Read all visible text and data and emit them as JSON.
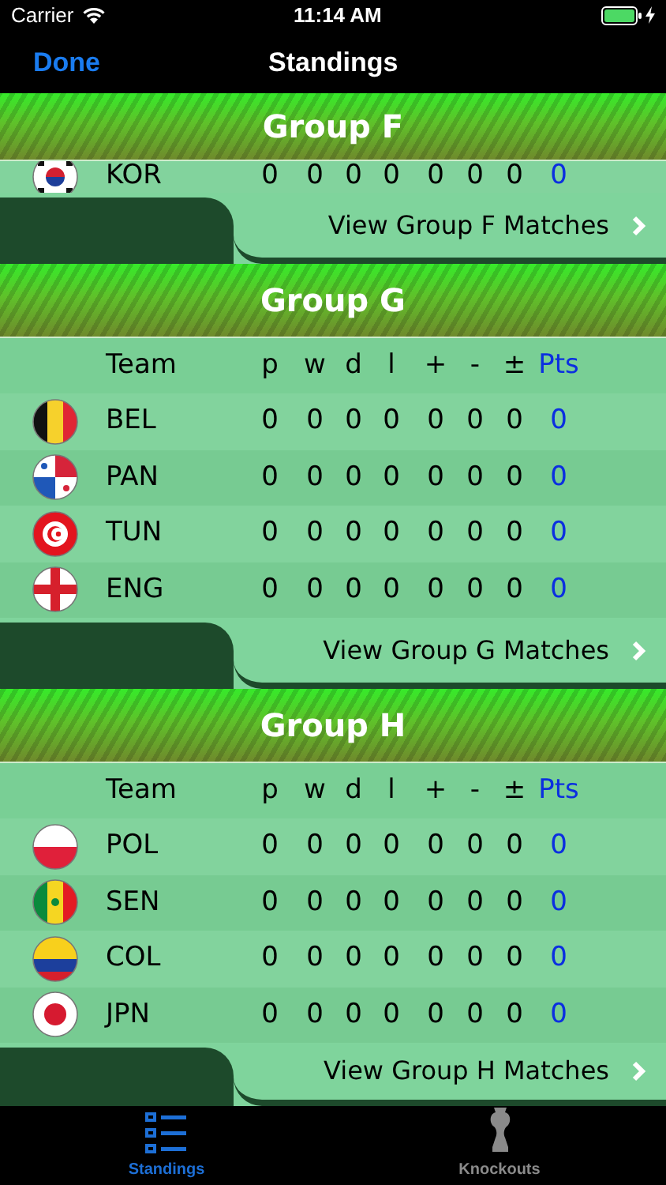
{
  "status_bar": {
    "carrier": "Carrier",
    "time": "11:14 AM"
  },
  "nav": {
    "back": "Done",
    "title": "Standings"
  },
  "groups": [
    {
      "title": "Group F",
      "partly_hidden": true,
      "teams": [
        {
          "kind": "kor",
          "code": "KOR",
          "stats": [
            "0",
            "0",
            "0",
            "0",
            "0",
            "0",
            "0"
          ],
          "pts": "0"
        }
      ],
      "footer": "View Group F Matches"
    },
    {
      "title": "Group G",
      "partly_hidden": false,
      "columns": [
        "Team",
        "p",
        "w",
        "d",
        "l",
        "+",
        "-",
        "±",
        "Pts"
      ],
      "teams": [
        {
          "kind": "bel",
          "code": "BEL",
          "stats": [
            "0",
            "0",
            "0",
            "0",
            "0",
            "0",
            "0"
          ],
          "pts": "0"
        },
        {
          "kind": "pan",
          "code": "PAN",
          "stats": [
            "0",
            "0",
            "0",
            "0",
            "0",
            "0",
            "0"
          ],
          "pts": "0"
        },
        {
          "kind": "tun",
          "code": "TUN",
          "stats": [
            "0",
            "0",
            "0",
            "0",
            "0",
            "0",
            "0"
          ],
          "pts": "0"
        },
        {
          "kind": "eng",
          "code": "ENG",
          "stats": [
            "0",
            "0",
            "0",
            "0",
            "0",
            "0",
            "0"
          ],
          "pts": "0"
        }
      ],
      "footer": "View Group G Matches"
    },
    {
      "title": "Group H",
      "partly_hidden": false,
      "columns": [
        "Team",
        "p",
        "w",
        "d",
        "l",
        "+",
        "-",
        "±",
        "Pts"
      ],
      "teams": [
        {
          "kind": "pol",
          "code": "POL",
          "stats": [
            "0",
            "0",
            "0",
            "0",
            "0",
            "0",
            "0"
          ],
          "pts": "0"
        },
        {
          "kind": "sen",
          "code": "SEN",
          "stats": [
            "0",
            "0",
            "0",
            "0",
            "0",
            "0",
            "0"
          ],
          "pts": "0"
        },
        {
          "kind": "col",
          "code": "COL",
          "stats": [
            "0",
            "0",
            "0",
            "0",
            "0",
            "0",
            "0"
          ],
          "pts": "0"
        },
        {
          "kind": "jpn",
          "code": "JPN",
          "stats": [
            "0",
            "0",
            "0",
            "0",
            "0",
            "0",
            "0"
          ],
          "pts": "0"
        }
      ],
      "footer": "View Group H Matches"
    }
  ],
  "tab_bar": [
    {
      "kind": "list",
      "label": "Standings",
      "selected": true
    },
    {
      "kind": "trophy",
      "label": "Knockouts",
      "selected": false
    }
  ]
}
